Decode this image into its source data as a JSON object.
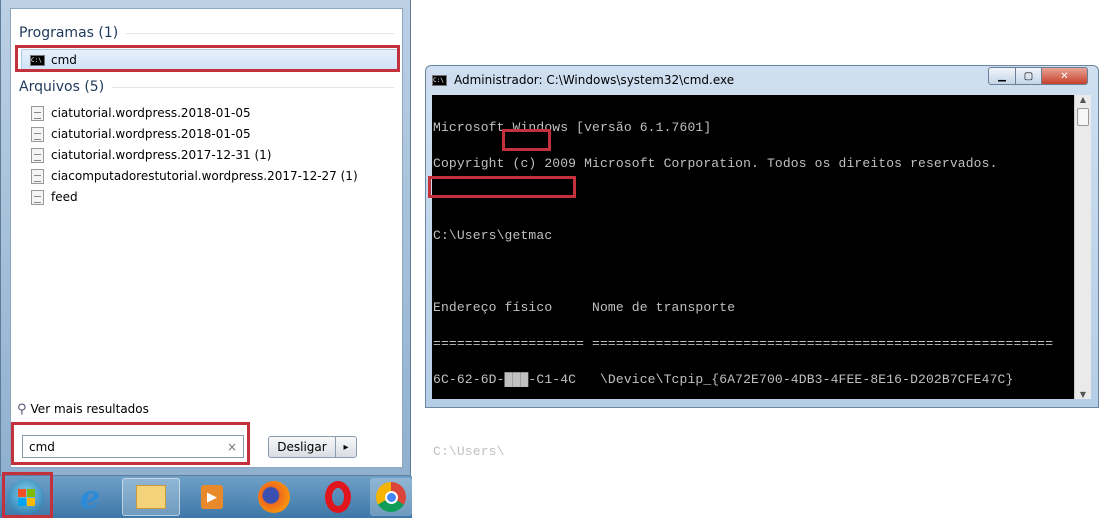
{
  "start_menu": {
    "programs_header": "Programas (1)",
    "programs": [
      {
        "label": "cmd",
        "icon": "cmd-icon"
      }
    ],
    "files_header": "Arquivos (5)",
    "files": [
      {
        "label": "ciatutorial.wordpress.2018-01-05"
      },
      {
        "label": "ciatutorial.wordpress.2018-01-05"
      },
      {
        "label": "ciatutorial.wordpress.2017-12-31 (1)"
      },
      {
        "label": "ciacomputadorestutorial.wordpress.2017-12-27 (1)"
      },
      {
        "label": "feed"
      }
    ],
    "see_more": "Ver mais resultados",
    "search_value": "cmd",
    "clear": "×",
    "shutdown": "Desligar",
    "shutdown_arrow": "▸"
  },
  "taskbar": {
    "icons": [
      "windows-start-icon",
      "internet-explorer-icon",
      "file-explorer-icon",
      "media-player-icon",
      "firefox-icon",
      "opera-icon",
      "chrome-icon"
    ]
  },
  "cmd_window": {
    "title": "Administrador: C:\\Windows\\system32\\cmd.exe",
    "lines": [
      "Microsoft Windows [versão 6.1.7601]",
      "Copyright (c) 2009 Microsoft Corporation. Todos os direitos reservados.",
      "",
      "C:\\Users\\getmac",
      "",
      "Endereço físico     Nome de transporte",
      "=================== ==========================================================",
      "6C-62-6D-███-C1-4C   \\Device\\Tcpip_{6A72E700-4DB3-4FEE-8E16-D202B7CFE47C}",
      "",
      "C:\\Users\\"
    ]
  },
  "colors": {
    "highlight": "#c2313c",
    "console_bg": "#000000",
    "console_fg": "#c0c0c0"
  }
}
